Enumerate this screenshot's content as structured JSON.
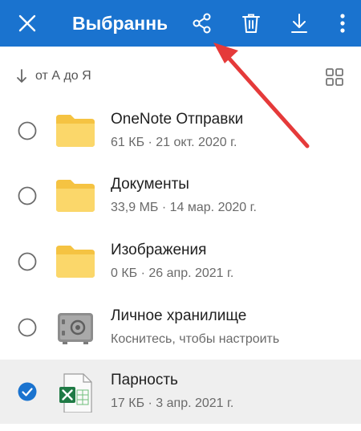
{
  "header": {
    "title": "Выбранные",
    "icons": [
      "close-icon",
      "share-icon",
      "delete-icon",
      "download-icon",
      "more-vert-icon"
    ],
    "accent_color": "#1a73cf"
  },
  "sort": {
    "label": "от А до Я",
    "icon": "arrow-down-icon",
    "view_icon": "grid-view-icon"
  },
  "files": [
    {
      "name": "OneNote Отправки",
      "meta": "61 КБ · 21 окт. 2020 г.",
      "type": "folder",
      "selected": false
    },
    {
      "name": "Документы",
      "meta": "33,9 МБ · 14 мар. 2020 г.",
      "type": "folder",
      "selected": false
    },
    {
      "name": "Изображения",
      "meta": "0 КБ · 26 апр. 2021 г.",
      "type": "folder",
      "selected": false
    },
    {
      "name": "Личное хранилище",
      "meta": "Коснитесь, чтобы настроить",
      "type": "vault",
      "selected": false
    },
    {
      "name": "Парность",
      "meta": "17 КБ · 3 апр. 2021 г.",
      "type": "excel",
      "selected": true
    }
  ],
  "annotation_color": "#e53a3a"
}
